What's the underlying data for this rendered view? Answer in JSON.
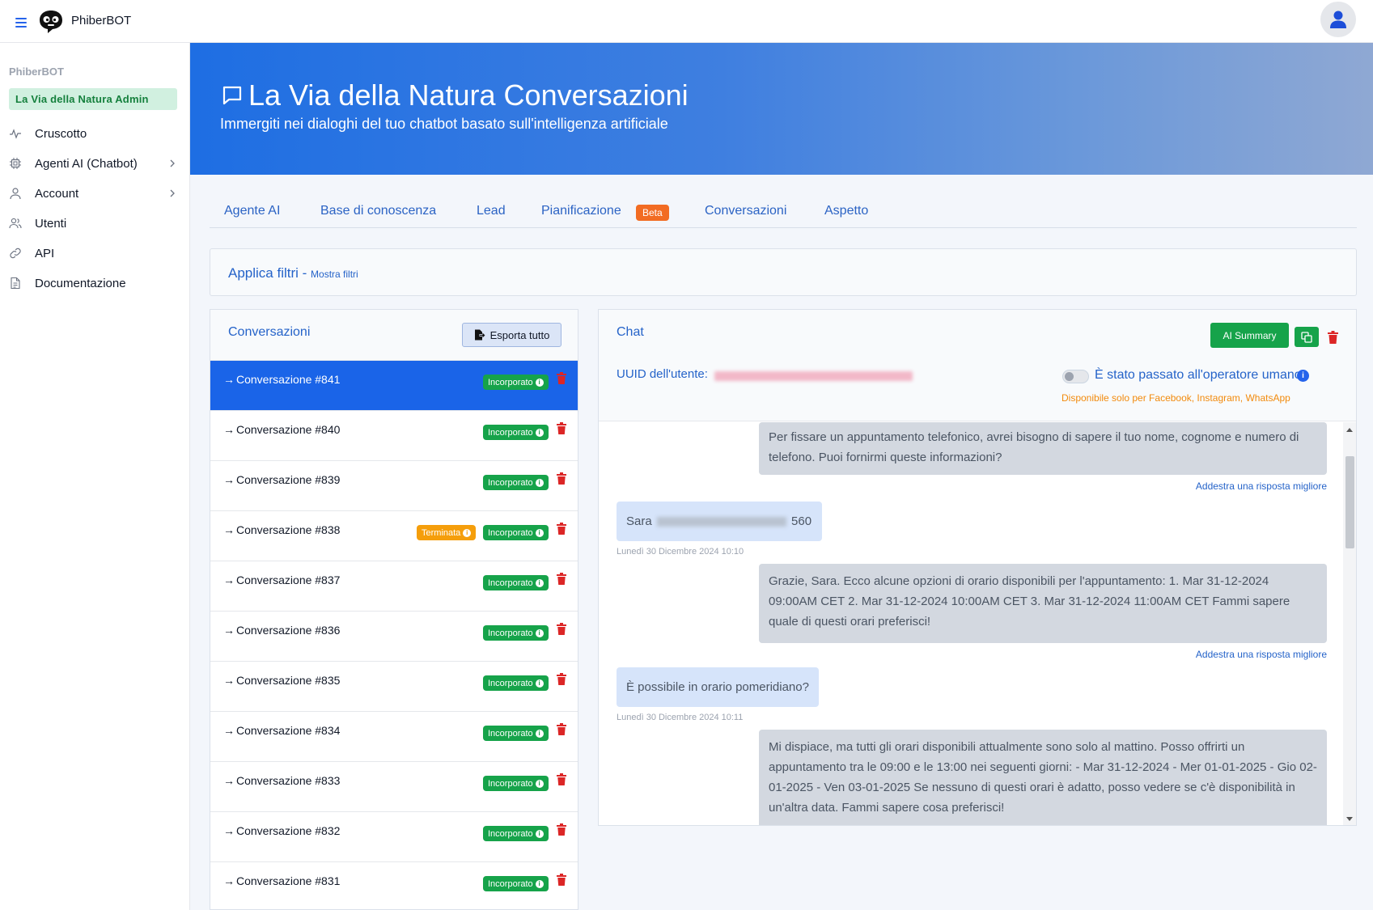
{
  "app": {
    "brand": "PhiberBOT"
  },
  "sidebar": {
    "org_label": "PhiberBOT",
    "workspace": "La Via della Natura Admin",
    "items": [
      {
        "label": "Cruscotto",
        "icon": "activity-icon"
      },
      {
        "label": "Agenti AI (Chatbot)",
        "icon": "cpu-icon",
        "has_submenu": true
      },
      {
        "label": "Account",
        "icon": "user-icon",
        "has_submenu": true
      },
      {
        "label": "Utenti",
        "icon": "users-icon"
      },
      {
        "label": "API",
        "icon": "link-icon"
      },
      {
        "label": "Documentazione",
        "icon": "document-icon"
      }
    ]
  },
  "hero": {
    "title": "La Via della Natura Conversazioni",
    "subtitle": "Immergiti nei dialoghi del tuo chatbot basato sull'intelligenza artificiale"
  },
  "tabs": [
    {
      "label": "Agente AI"
    },
    {
      "label": "Base di conoscenza"
    },
    {
      "label": "Lead"
    },
    {
      "label": "Pianificazione",
      "badge": "Beta"
    },
    {
      "label": "Conversazioni"
    },
    {
      "label": "Aspetto"
    }
  ],
  "filters": {
    "title": "Applica filtri - ",
    "toggle": "Mostra filtri"
  },
  "conversations": {
    "title": "Conversazioni",
    "export_label": "Esporta tutto",
    "items": [
      {
        "name": "Conversazione #841",
        "status": "Incorporato",
        "active": true
      },
      {
        "name": "Conversazione #840",
        "status": "Incorporato"
      },
      {
        "name": "Conversazione #839",
        "status": "Incorporato"
      },
      {
        "name": "Conversazione #838",
        "status": "Incorporato",
        "extra": "Terminata"
      },
      {
        "name": "Conversazione #837",
        "status": "Incorporato"
      },
      {
        "name": "Conversazione #836",
        "status": "Incorporato"
      },
      {
        "name": "Conversazione #835",
        "status": "Incorporato"
      },
      {
        "name": "Conversazione #834",
        "status": "Incorporato"
      },
      {
        "name": "Conversazione #833",
        "status": "Incorporato"
      },
      {
        "name": "Conversazione #832",
        "status": "Incorporato"
      },
      {
        "name": "Conversazione #831",
        "status": "Incorporato"
      }
    ]
  },
  "chat": {
    "title": "Chat",
    "ai_summary_label": "AI Summary",
    "uuid_label": "UUID dell'utente:",
    "handoff_label": "È stato passato all'operatore umano",
    "handoff_note": "Disponibile solo per Facebook, Instagram, WhatsApp",
    "train_label": "Addestra una risposta migliore",
    "messages": [
      {
        "role": "bot",
        "text": "Per fissare un appuntamento telefonico, avrei bisogno di sapere il tuo nome, cognome e numero di telefono. Puoi fornirmi queste informazioni?"
      },
      {
        "role": "user",
        "prefix": "Sara",
        "suffix": "560",
        "time": "Lunedì 30 Dicembre 2024 10:10"
      },
      {
        "role": "bot",
        "text": "Grazie, Sara. Ecco alcune opzioni di orario disponibili per l'appuntamento: 1. Mar 31-12-2024 09:00AM CET 2. Mar 31-12-2024 10:00AM CET 3. Mar 31-12-2024 11:00AM CET Fammi sapere quale di questi orari preferisci!"
      },
      {
        "role": "user",
        "text": "È possibile in orario pomeridiano?",
        "time": "Lunedì 30 Dicembre 2024 10:11"
      },
      {
        "role": "bot",
        "text": "Mi dispiace, ma tutti gli orari disponibili attualmente sono solo al mattino. Posso offrirti un appuntamento tra le 09:00 e le 13:00 nei seguenti giorni: - Mar 31-12-2024 - Mer 01-01-2025 - Gio 02-01-2025 - Ven 03-01-2025 Se nessuno di questi orari è adatto, posso vedere se c'è disponibilità in un'altra data. Fammi sapere cosa preferisci!"
      }
    ]
  },
  "colors": {
    "primary": "#2563eb",
    "active_row": "#1a64e8",
    "success": "#16a34a",
    "warning": "#f59e0b",
    "danger": "#dc2626",
    "beta": "#f26c23"
  }
}
